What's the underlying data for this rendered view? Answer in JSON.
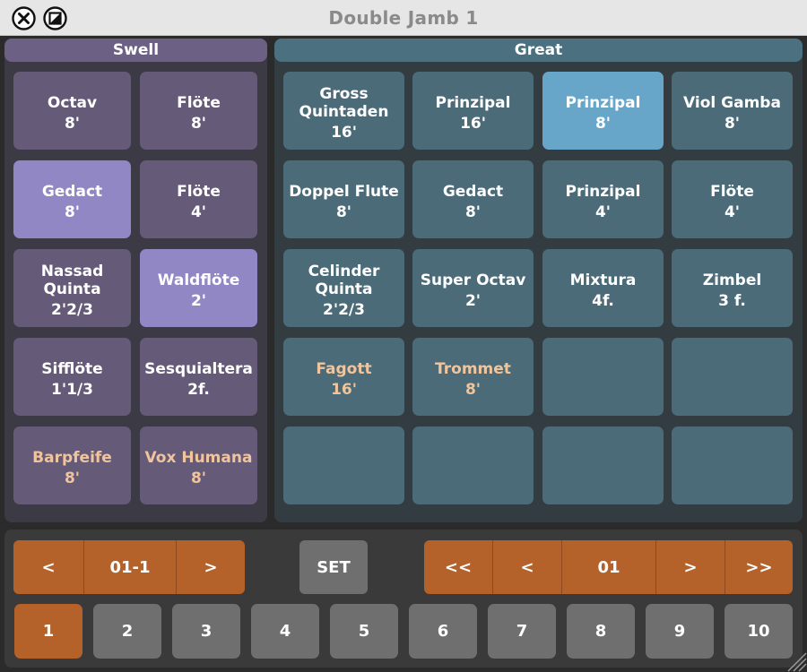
{
  "window": {
    "title": "Double Jamb 1"
  },
  "icons": {
    "close": "close-circle-icon",
    "zoom": "resize-square-icon",
    "grip": "resize-grip-icon"
  },
  "colors": {
    "swell_off": "#655a78",
    "swell_on": "#9287c5",
    "great_off": "#4b6b79",
    "great_on": "#67a6c8",
    "reed_text": "#f0c49c",
    "accent": "#b5612a"
  },
  "swell": {
    "title": "Swell",
    "stops": [
      {
        "name": "Octav",
        "pitch": "8'",
        "on": false,
        "reed": false
      },
      {
        "name": "Flöte",
        "pitch": "8'",
        "on": false,
        "reed": false
      },
      {
        "name": "Gedact",
        "pitch": "8'",
        "on": true,
        "reed": false
      },
      {
        "name": "Flöte",
        "pitch": "4'",
        "on": false,
        "reed": false
      },
      {
        "name": "Nassad Quinta",
        "pitch": "2'2/3",
        "on": false,
        "reed": false
      },
      {
        "name": "Waldflöte",
        "pitch": "2'",
        "on": true,
        "reed": false
      },
      {
        "name": "Sifflöte",
        "pitch": "1'1/3",
        "on": false,
        "reed": false
      },
      {
        "name": "Sesquialtera",
        "pitch": "2f.",
        "on": false,
        "reed": false
      },
      {
        "name": "Barpfeife",
        "pitch": "8'",
        "on": false,
        "reed": true
      },
      {
        "name": "Vox Humana",
        "pitch": "8'",
        "on": false,
        "reed": true
      }
    ]
  },
  "great": {
    "title": "Great",
    "stops": [
      {
        "name": "Gross\nQuintaden",
        "pitch": "16'",
        "on": false,
        "reed": false
      },
      {
        "name": "Prinzipal",
        "pitch": "16'",
        "on": false,
        "reed": false
      },
      {
        "name": "Prinzipal",
        "pitch": "8'",
        "on": true,
        "reed": false
      },
      {
        "name": "Viol Gamba",
        "pitch": "8'",
        "on": false,
        "reed": false
      },
      {
        "name": "Doppel Flute",
        "pitch": "8'",
        "on": false,
        "reed": false
      },
      {
        "name": "Gedact",
        "pitch": "8'",
        "on": false,
        "reed": false
      },
      {
        "name": "Prinzipal",
        "pitch": "4'",
        "on": false,
        "reed": false
      },
      {
        "name": "Flöte",
        "pitch": "4'",
        "on": false,
        "reed": false
      },
      {
        "name": "Celinder\nQuinta",
        "pitch": "2'2/3",
        "on": false,
        "reed": false
      },
      {
        "name": "Super Octav",
        "pitch": "2'",
        "on": false,
        "reed": false
      },
      {
        "name": "Mixtura",
        "pitch": "4f.",
        "on": false,
        "reed": false
      },
      {
        "name": "Zimbel",
        "pitch": "3 f.",
        "on": false,
        "reed": false
      },
      {
        "name": "Fagott",
        "pitch": "16'",
        "on": false,
        "reed": true
      },
      {
        "name": "Trommet",
        "pitch": "8'",
        "on": false,
        "reed": true
      },
      {
        "name": "",
        "pitch": "",
        "on": false,
        "reed": false
      },
      {
        "name": "",
        "pitch": "",
        "on": false,
        "reed": false
      },
      {
        "name": "",
        "pitch": "",
        "on": false,
        "reed": false
      },
      {
        "name": "",
        "pitch": "",
        "on": false,
        "reed": false
      },
      {
        "name": "",
        "pitch": "",
        "on": false,
        "reed": false
      },
      {
        "name": "",
        "pitch": "",
        "on": false,
        "reed": false
      }
    ]
  },
  "combination": {
    "prev": "<",
    "current": "01-1",
    "next": ">",
    "set": "SET",
    "bank_first": "<<",
    "bank_prev": "<",
    "bank": "01",
    "bank_next": ">",
    "bank_last": ">>",
    "memory_buttons": [
      "1",
      "2",
      "3",
      "4",
      "5",
      "6",
      "7",
      "8",
      "9",
      "10"
    ],
    "active_memory": "1"
  }
}
